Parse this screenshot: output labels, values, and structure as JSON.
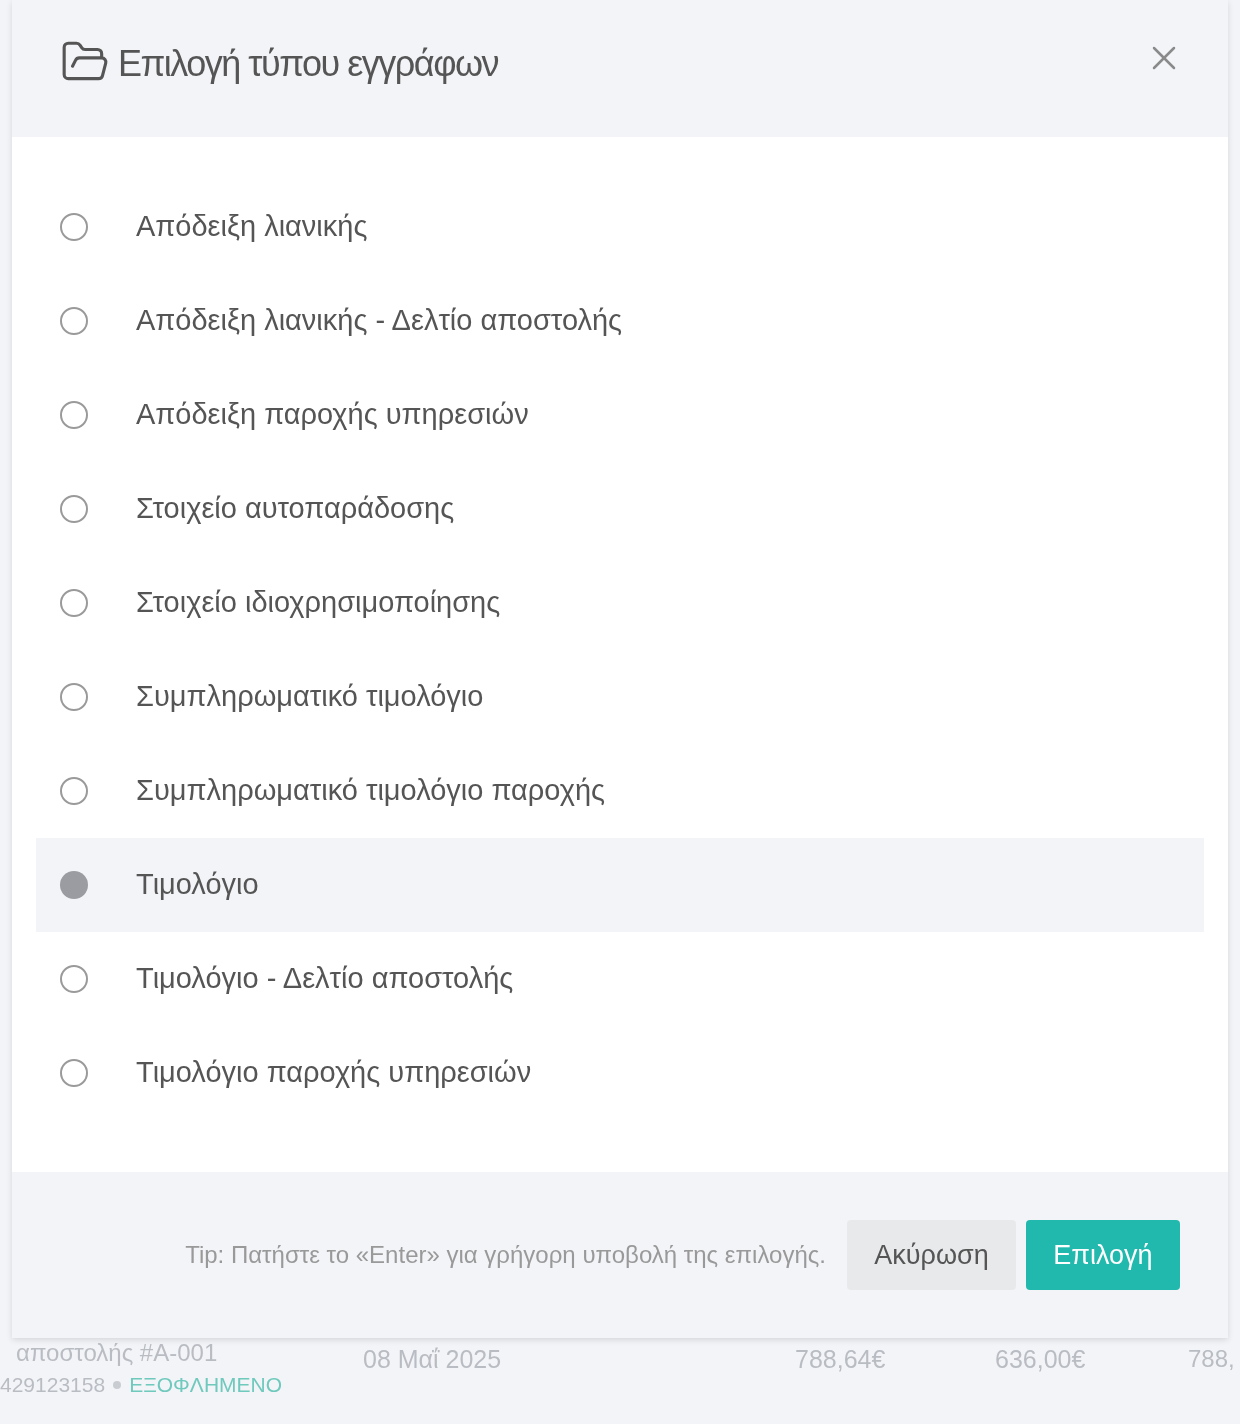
{
  "dialog": {
    "title": "Επιλογή τύπου εγγράφων",
    "options": [
      {
        "label": "Απόδειξη λιανικής",
        "selected": false
      },
      {
        "label": "Απόδειξη λιανικής - Δελτίο αποστολής",
        "selected": false
      },
      {
        "label": "Απόδειξη παροχής υπηρεσιών",
        "selected": false
      },
      {
        "label": "Στοιχείο αυτοπαράδοσης",
        "selected": false
      },
      {
        "label": "Στοιχείο ιδιοχρησιμοποίησης",
        "selected": false
      },
      {
        "label": "Συμπληρωματικό τιμολόγιο",
        "selected": false
      },
      {
        "label": "Συμπληρωματικό τιμολόγιο παροχής",
        "selected": false
      },
      {
        "label": "Τιμολόγιο",
        "selected": true
      },
      {
        "label": "Τιμολόγιο - Δελτίο αποστολής",
        "selected": false
      },
      {
        "label": "Τιμολόγιο παροχής υπηρεσιών",
        "selected": false
      }
    ],
    "tip": "Tip: Πατήστε το «Enter» για γρήγορη υποβολή της επιλογής.",
    "buttons": [
      {
        "label": "Ακύρωση",
        "kind": "secondary"
      },
      {
        "label": "Επιλογή",
        "kind": "primary"
      }
    ]
  },
  "background_row": {
    "title": "αποστολής #Α-001",
    "number": "429123158",
    "status": "ΕΞΟΦΛΗΜΕΝΟ",
    "date": "08 Μαΐ 2025",
    "column_4": "788,64€",
    "column_5": "636,00€",
    "column_6": "788,"
  }
}
